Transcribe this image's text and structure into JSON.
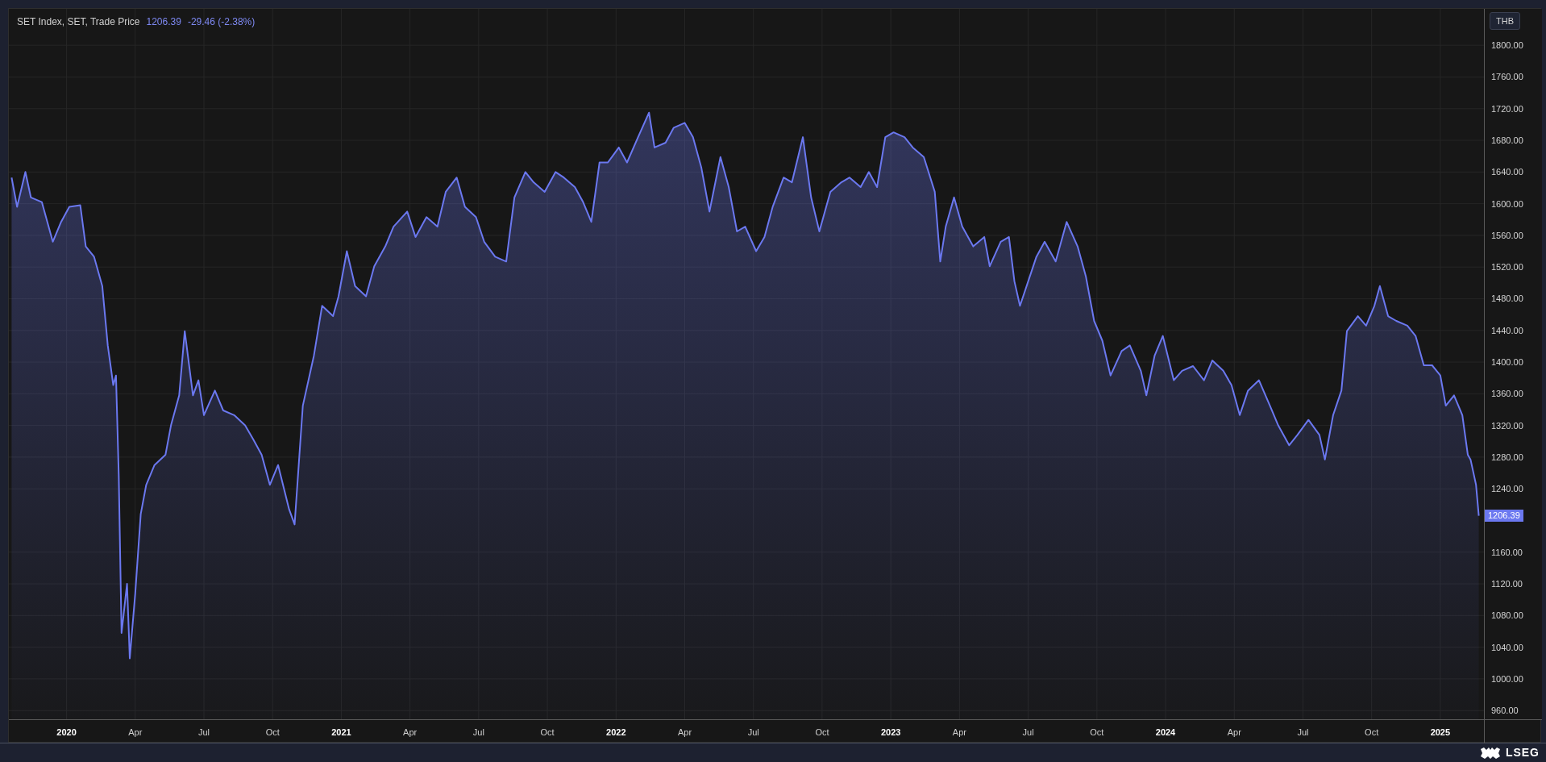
{
  "chart": {
    "legend": {
      "title": "SET Index, SET, Trade Price",
      "price": "1206.39",
      "change": "-29.46 (-2.38%)"
    },
    "currency": "THB",
    "last_price": {
      "label": "1206.39"
    },
    "chart_data": {
      "type": "area",
      "grid": true,
      "xlim": [
        2019.79,
        2025.37
      ],
      "ylim": [
        949,
        1846
      ],
      "yticks": [
        {
          "value": 960,
          "label": "960.00"
        },
        {
          "value": 1000,
          "label": "1000.00"
        },
        {
          "value": 1040,
          "label": "1040.00"
        },
        {
          "value": 1080,
          "label": "1080.00"
        },
        {
          "value": 1120,
          "label": "1120.00"
        },
        {
          "value": 1160,
          "label": "1160.00"
        },
        {
          "value": 1240,
          "label": "1240.00"
        },
        {
          "value": 1280,
          "label": "1280.00"
        },
        {
          "value": 1320,
          "label": "1320.00"
        },
        {
          "value": 1360,
          "label": "1360.00"
        },
        {
          "value": 1400,
          "label": "1400.00"
        },
        {
          "value": 1440,
          "label": "1440.00"
        },
        {
          "value": 1480,
          "label": "1480.00"
        },
        {
          "value": 1520,
          "label": "1520.00"
        },
        {
          "value": 1560,
          "label": "1560.00"
        },
        {
          "value": 1600,
          "label": "1600.00"
        },
        {
          "value": 1640,
          "label": "1640.00"
        },
        {
          "value": 1680,
          "label": "1680.00"
        },
        {
          "value": 1720,
          "label": "1720.00"
        },
        {
          "value": 1760,
          "label": "1760.00"
        },
        {
          "value": 1800,
          "label": "1800.00"
        }
      ],
      "xticks": [
        {
          "value": 2020,
          "label": "2020"
        },
        {
          "value": 2020.25,
          "label": "Apr"
        },
        {
          "value": 2020.5,
          "label": "Jul"
        },
        {
          "value": 2020.75,
          "label": "Oct"
        },
        {
          "value": 2021,
          "label": "2021"
        },
        {
          "value": 2021.25,
          "label": "Apr"
        },
        {
          "value": 2021.5,
          "label": "Jul"
        },
        {
          "value": 2021.75,
          "label": "Oct"
        },
        {
          "value": 2022,
          "label": "2022"
        },
        {
          "value": 2022.25,
          "label": "Apr"
        },
        {
          "value": 2022.5,
          "label": "Jul"
        },
        {
          "value": 2022.75,
          "label": "Oct"
        },
        {
          "value": 2023,
          "label": "2023"
        },
        {
          "value": 2023.25,
          "label": "Apr"
        },
        {
          "value": 2023.5,
          "label": "Jul"
        },
        {
          "value": 2023.75,
          "label": "Oct"
        },
        {
          "value": 2024,
          "label": "2024"
        },
        {
          "value": 2024.25,
          "label": "Apr"
        },
        {
          "value": 2024.5,
          "label": "Jul"
        },
        {
          "value": 2024.75,
          "label": "Oct"
        },
        {
          "value": 2025,
          "label": "2025"
        }
      ],
      "x": [
        2019.8,
        2019.82,
        2019.85,
        2019.87,
        2019.91,
        2019.95,
        2019.98,
        2020.01,
        2020.05,
        2020.07,
        2020.1,
        2020.13,
        2020.15,
        2020.17,
        2020.18,
        2020.19,
        2020.2,
        2020.22,
        2020.23,
        2020.25,
        2020.27,
        2020.29,
        2020.32,
        2020.36,
        2020.38,
        2020.41,
        2020.43,
        2020.46,
        2020.48,
        2020.5,
        2020.54,
        2020.57,
        2020.61,
        2020.65,
        2020.68,
        2020.71,
        2020.74,
        2020.77,
        2020.81,
        2020.83,
        2020.86,
        2020.9,
        2020.93,
        2020.97,
        2020.99,
        2021.02,
        2021.05,
        2021.09,
        2021.12,
        2021.16,
        2021.19,
        2021.24,
        2021.27,
        2021.31,
        2021.35,
        2021.38,
        2021.42,
        2021.45,
        2021.49,
        2021.52,
        2021.56,
        2021.6,
        2021.63,
        2021.67,
        2021.7,
        2021.74,
        2021.78,
        2021.81,
        2021.85,
        2021.88,
        2021.91,
        2021.94,
        2021.97,
        2022.01,
        2022.04,
        2022.08,
        2022.12,
        2022.14,
        2022.18,
        2022.21,
        2022.25,
        2022.28,
        2022.31,
        2022.34,
        2022.38,
        2022.41,
        2022.44,
        2022.47,
        2022.51,
        2022.54,
        2022.57,
        2022.61,
        2022.64,
        2022.68,
        2022.71,
        2022.74,
        2022.78,
        2022.82,
        2022.85,
        2022.89,
        2022.92,
        2022.95,
        2022.98,
        2023.01,
        2023.05,
        2023.08,
        2023.12,
        2023.16,
        2023.18,
        2023.2,
        2023.23,
        2023.26,
        2023.3,
        2023.34,
        2023.36,
        2023.4,
        2023.43,
        2023.45,
        2023.47,
        2023.5,
        2023.53,
        2023.56,
        2023.6,
        2023.64,
        2023.68,
        2023.71,
        2023.74,
        2023.77,
        2023.8,
        2023.84,
        2023.87,
        2023.91,
        2023.93,
        2023.96,
        2023.99,
        2024.03,
        2024.06,
        2024.1,
        2024.14,
        2024.17,
        2024.21,
        2024.24,
        2024.27,
        2024.3,
        2024.34,
        2024.38,
        2024.41,
        2024.45,
        2024.48,
        2024.52,
        2024.56,
        2024.58,
        2024.61,
        2024.64,
        2024.66,
        2024.7,
        2024.73,
        2024.76,
        2024.78,
        2024.81,
        2024.84,
        2024.88,
        2024.91,
        2024.94,
        2024.97,
        2025.0,
        2025.02,
        2025.05,
        2025.08,
        2025.1,
        2025.11,
        2025.13,
        2025.14
      ],
      "series": [
        {
          "color": "#6b78f0",
          "values": [
            1633,
            1596,
            1640,
            1608,
            1602,
            1552,
            1577,
            1596,
            1598,
            1546,
            1533,
            1496,
            1421,
            1371,
            1383,
            1258,
            1058,
            1120,
            1026,
            1108,
            1208,
            1245,
            1270,
            1283,
            1320,
            1358,
            1439,
            1358,
            1377,
            1333,
            1364,
            1339,
            1333,
            1320,
            1302,
            1283,
            1245,
            1270,
            1214,
            1195,
            1345,
            1408,
            1471,
            1458,
            1483,
            1540,
            1496,
            1483,
            1521,
            1546,
            1571,
            1590,
            1558,
            1583,
            1571,
            1615,
            1633,
            1596,
            1583,
            1552,
            1533,
            1527,
            1608,
            1640,
            1627,
            1615,
            1640,
            1633,
            1621,
            1602,
            1577,
            1652,
            1652,
            1671,
            1652,
            1684,
            1715,
            1671,
            1677,
            1696,
            1702,
            1684,
            1646,
            1590,
            1659,
            1621,
            1565,
            1571,
            1540,
            1558,
            1596,
            1633,
            1627,
            1684,
            1608,
            1565,
            1615,
            1627,
            1633,
            1621,
            1640,
            1621,
            1684,
            1690,
            1684,
            1671,
            1659,
            1615,
            1527,
            1571,
            1608,
            1571,
            1546,
            1558,
            1521,
            1552,
            1558,
            1502,
            1471,
            1502,
            1533,
            1552,
            1527,
            1577,
            1546,
            1508,
            1452,
            1427,
            1383,
            1414,
            1421,
            1389,
            1358,
            1408,
            1433,
            1377,
            1389,
            1395,
            1377,
            1402,
            1389,
            1371,
            1333,
            1364,
            1377,
            1345,
            1320,
            1295,
            1308,
            1327,
            1308,
            1277,
            1333,
            1364,
            1439,
            1458,
            1446,
            1471,
            1496,
            1458,
            1452,
            1446,
            1433,
            1396,
            1396,
            1383,
            1345,
            1358,
            1333,
            1283,
            1277,
            1245,
            1206
          ]
        }
      ]
    }
  },
  "footer": {
    "brand": "LSEG"
  }
}
